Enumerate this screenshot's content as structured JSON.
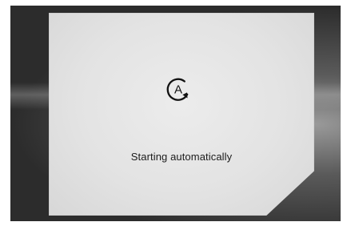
{
  "screen": {
    "status_text": "Starting automatically",
    "icon": "auto-restart-icon",
    "icon_letter": "A"
  }
}
